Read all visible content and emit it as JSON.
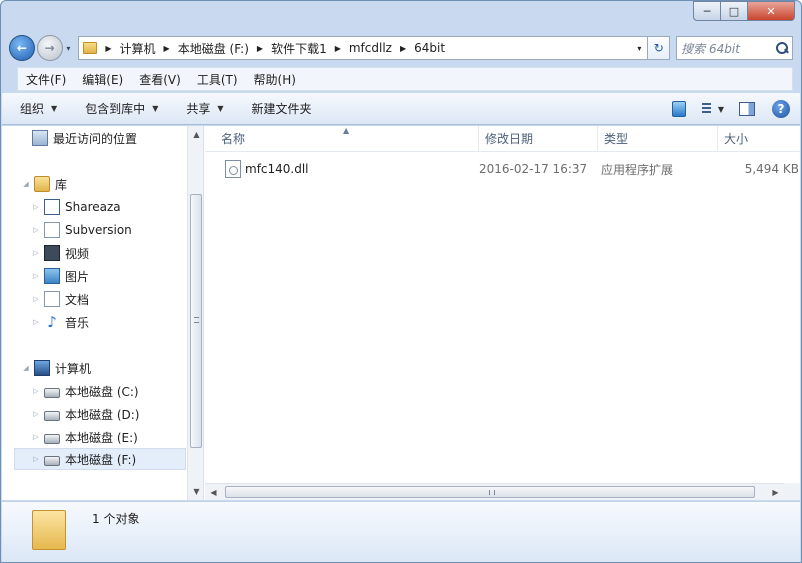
{
  "window": {
    "caption_buttons": {
      "minimize": "─",
      "maximize": "□",
      "close": "✕"
    }
  },
  "navigation": {
    "back_glyph": "←",
    "forward_glyph": "→",
    "dropdown_glyph": "▾"
  },
  "address": {
    "crumbs": [
      "计算机",
      "本地磁盘 (F:)",
      "软件下载1",
      "mfcdllz",
      "64bit"
    ],
    "refresh_glyph": "↻"
  },
  "search": {
    "placeholder": "搜索 64bit"
  },
  "menu": {
    "items": [
      "文件(F)",
      "编辑(E)",
      "查看(V)",
      "工具(T)",
      "帮助(H)"
    ]
  },
  "toolbar": {
    "organize": "组织",
    "include_in_library": "包含到库中",
    "share": "共享",
    "new_folder": "新建文件夹",
    "help_glyph": "?"
  },
  "navpane": {
    "items": [
      {
        "label": "最近访问的位置",
        "icon": "recent-places-icon"
      },
      {
        "label": "库",
        "icon": "library-icon"
      },
      {
        "label": "Shareaza",
        "icon": "shareaza-icon"
      },
      {
        "label": "Subversion",
        "icon": "subversion-icon"
      },
      {
        "label": "视频",
        "icon": "video-icon"
      },
      {
        "label": "图片",
        "icon": "pictures-icon"
      },
      {
        "label": "文档",
        "icon": "documents-icon"
      },
      {
        "label": "音乐",
        "icon": "music-icon"
      },
      {
        "label": "计算机",
        "icon": "computer-icon"
      },
      {
        "label": "本地磁盘 (C:)",
        "icon": "drive-icon"
      },
      {
        "label": "本地磁盘 (D:)",
        "icon": "drive-icon"
      },
      {
        "label": "本地磁盘 (E:)",
        "icon": "drive-icon"
      },
      {
        "label": "本地磁盘 (F:)",
        "icon": "drive-icon",
        "selected": true
      }
    ],
    "music_glyph": "♪"
  },
  "columns": {
    "name": "名称",
    "date": "修改日期",
    "type": "类型",
    "size": "大小"
  },
  "files": [
    {
      "name": "mfc140.dll",
      "date": "2016-02-17 16:37",
      "type": "应用程序扩展",
      "size": "5,494 KB"
    }
  ],
  "status": {
    "count": "1 个对象"
  },
  "colors": {
    "frame": "#c9d9ef",
    "selection": "#e4eefb",
    "link_blue": "#1f5fb0"
  }
}
